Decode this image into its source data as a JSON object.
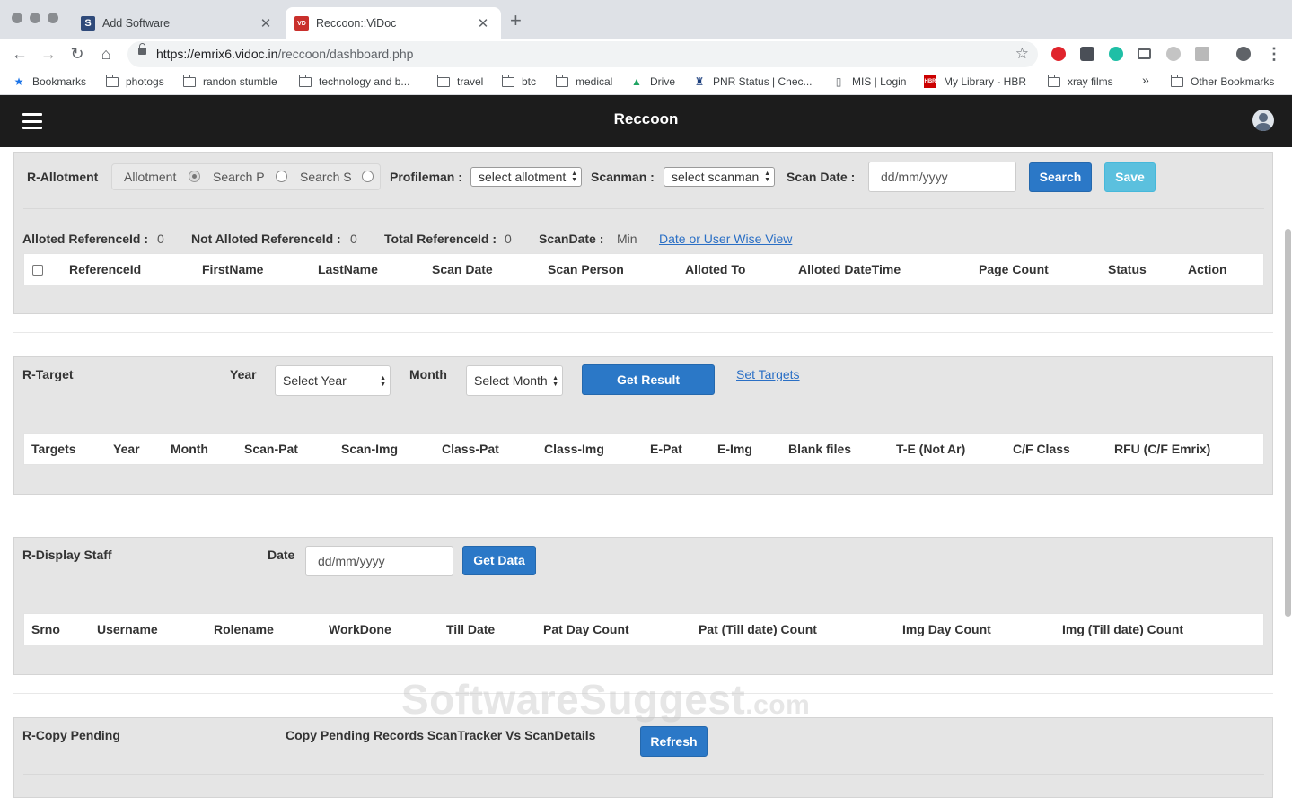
{
  "browser": {
    "tabs": [
      {
        "title": "Add Software",
        "favicon": "S"
      },
      {
        "title": "Reccoon::ViDoc",
        "favicon": "VD"
      }
    ],
    "url_host": "https://emrix6.vidoc.in",
    "url_path": "/reccoon/dashboard.php",
    "bookmarks": [
      {
        "label": "Bookmarks",
        "icon": "star-icon"
      },
      {
        "label": "photogs",
        "icon": "folder-icon"
      },
      {
        "label": "randon stumble",
        "icon": "folder-icon"
      },
      {
        "label": "technology and b...",
        "icon": "folder-icon"
      },
      {
        "label": "travel",
        "icon": "folder-icon"
      },
      {
        "label": "btc",
        "icon": "folder-icon"
      },
      {
        "label": "medical",
        "icon": "folder-icon"
      },
      {
        "label": "Drive",
        "icon": "drive-icon"
      },
      {
        "label": "PNR Status | Chec...",
        "icon": "train-icon"
      },
      {
        "label": "MIS | Login",
        "icon": "page-icon"
      },
      {
        "label": "My Library - HBR",
        "icon": "hbr-icon"
      },
      {
        "label": "xray films",
        "icon": "folder-icon"
      },
      {
        "label": "Other Bookmarks",
        "icon": "folder-icon"
      }
    ],
    "more_glyph": "»"
  },
  "app": {
    "title": "Reccoon"
  },
  "allotment": {
    "section_label": "R-Allotment",
    "radio_allotment": "Allotment",
    "radio_search_p": "Search P",
    "radio_search_s": "Search S",
    "profileman_label": "Profileman :",
    "profileman_value": "select allotment",
    "scanman_label": "Scanman :",
    "scanman_value": "select scanman",
    "scan_date_label": "Scan Date :",
    "scan_date_placeholder": "dd/mm/yyyy",
    "search_button": "Search",
    "save_button": "Save",
    "alloted_label": "Alloted ReferenceId :",
    "alloted_value": "0",
    "not_alloted_label": "Not Alloted ReferenceId :",
    "not_alloted_value": "0",
    "total_label": "Total ReferenceId :",
    "total_value": "0",
    "scandate_label": "ScanDate :",
    "scandate_value": "Min",
    "view_link": "Date or User Wise View",
    "columns": [
      "ReferenceId",
      "FirstName",
      "LastName",
      "Scan Date",
      "Scan Person",
      "Alloted To",
      "Alloted DateTime",
      "Page Count",
      "Status",
      "Action"
    ]
  },
  "target": {
    "section_label": "R-Target",
    "year_label": "Year",
    "year_value": "Select Year",
    "month_label": "Month",
    "month_value": "Select Month",
    "get_result_button": "Get Result",
    "set_targets_link": "Set Targets",
    "columns": [
      "Targets",
      "Year",
      "Month",
      "Scan-Pat",
      "Scan-Img",
      "Class-Pat",
      "Class-Img",
      "E-Pat",
      "E-Img",
      "Blank files",
      "T-E (Not Ar)",
      "C/F Class",
      "RFU (C/F Emrix)"
    ]
  },
  "staff": {
    "section_label": "R-Display Staff",
    "date_label": "Date",
    "date_placeholder": "dd/mm/yyyy",
    "get_data_button": "Get Data",
    "columns": [
      "Srno",
      "Username",
      "Rolename",
      "WorkDone",
      "Till Date",
      "Pat Day Count",
      "Pat (Till date) Count",
      "Img Day Count",
      "Img (Till date) Count"
    ]
  },
  "copy_pending": {
    "section_label": "R-Copy Pending",
    "description": "Copy Pending Records ScanTracker Vs ScanDetails",
    "refresh_button": "Refresh"
  },
  "watermark": {
    "main": "SoftwareSuggest",
    "suffix": ".com"
  }
}
